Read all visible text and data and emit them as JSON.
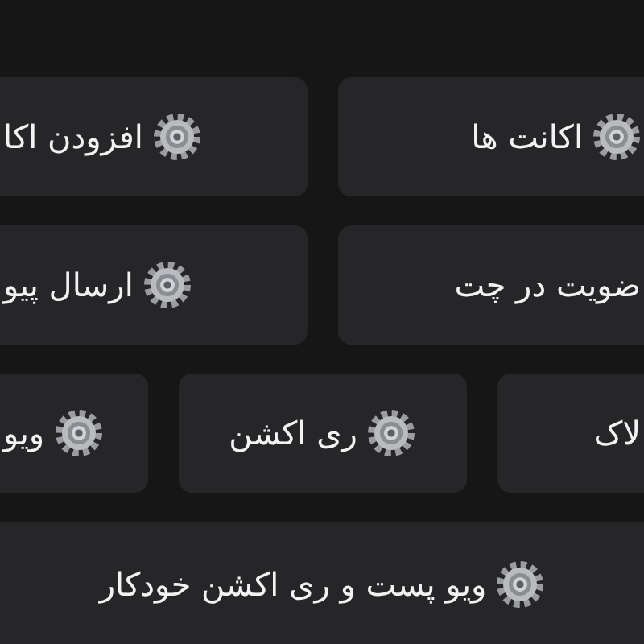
{
  "keyboard": {
    "rows": [
      {
        "buttons": [
          {
            "label": "اکانت ها",
            "gear": true
          },
          {
            "label": "افزودن اکا",
            "gear": true
          }
        ]
      },
      {
        "buttons": [
          {
            "label": "ضویت در چت",
            "gear": false
          },
          {
            "label": "ارسال پیو",
            "gear": true
          }
        ]
      },
      {
        "buttons": [
          {
            "label": "لاک",
            "gear": false
          },
          {
            "label": "ری اکشن",
            "gear": true
          },
          {
            "label": "ویو",
            "gear": true
          }
        ]
      },
      {
        "buttons": [
          {
            "label": "ویو پست و ری اکشن خودکار",
            "gear": true
          }
        ]
      }
    ]
  }
}
